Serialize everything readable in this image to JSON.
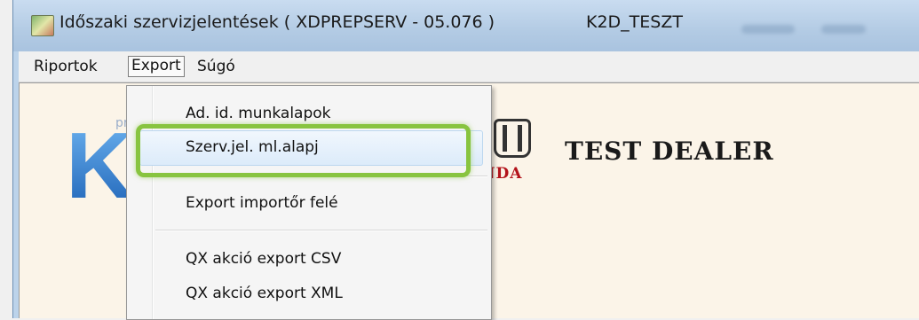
{
  "window": {
    "title": "Időszaki szervizjelentések ( XDPREPSERV - 05.076 )",
    "database": "K2D_TESZT",
    "icon": "app-icon"
  },
  "menubar": {
    "items": [
      {
        "label": "Riportok"
      },
      {
        "label": "Export"
      },
      {
        "label": "Súgó"
      }
    ]
  },
  "dropdown": {
    "items": [
      {
        "label": "Ad. id. munkalapok"
      },
      {
        "label": "Szerv.jel. ml.alapj"
      },
      {
        "label": "Export importőr felé"
      },
      {
        "label": "QX akció export CSV"
      },
      {
        "label": "QX akció export XML"
      }
    ],
    "highlight_color": "#88c440"
  },
  "content": {
    "logo_pro": "pro",
    "logo_letter": "K",
    "brand_word": "NDA",
    "dealer_name": "TEST DEALER"
  }
}
